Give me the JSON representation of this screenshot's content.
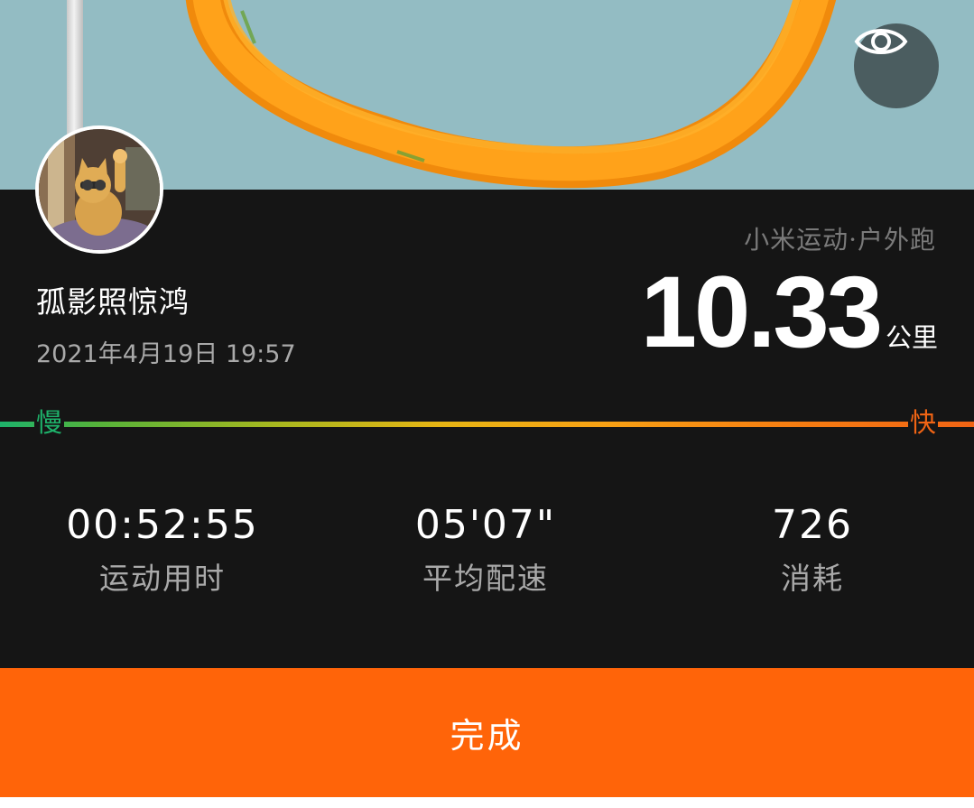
{
  "map": {
    "route_color": "#ff9a12",
    "background_color": "#93bcc3",
    "toggle_icon": "eye-icon"
  },
  "profile": {
    "avatar_icon": "cat-avatar",
    "username": "孤影照惊鸿",
    "datetime": "2021年4月19日  19:57"
  },
  "workout": {
    "source": "小米运动·户外跑",
    "distance": "10.33",
    "distance_unit": "公里"
  },
  "speed_legend": {
    "slow": "慢",
    "fast": "快",
    "slow_color": "#1eb36b",
    "fast_color": "#f06414"
  },
  "stats": [
    {
      "value": "00:52:55",
      "label": "运动用时"
    },
    {
      "value": "05'07\"",
      "label": "平均配速"
    },
    {
      "value": "726",
      "label": "消耗"
    }
  ],
  "actions": {
    "done_label": "完成",
    "done_color": "#ff6409"
  }
}
